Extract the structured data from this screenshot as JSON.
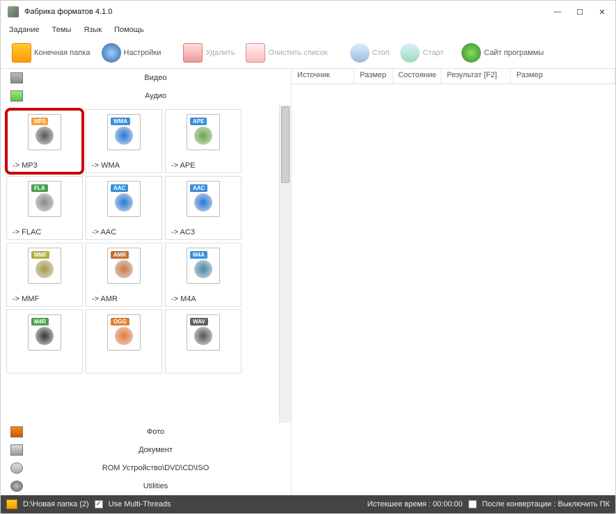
{
  "title": "Фабрика форматов 4.1.0",
  "menu": {
    "task": "Задание",
    "theme": "Темы",
    "lang": "Язык",
    "help": "Помощь"
  },
  "toolbar": {
    "output_folder": "Конечная папка",
    "settings": "Настройки",
    "delete": "Удалить",
    "clear": "Очистить список",
    "stop": "Стоп",
    "start": "Старт",
    "site": "Сайт программы"
  },
  "categories": {
    "video": "Видео",
    "audio": "Аудио",
    "photo": "Фото",
    "document": "Документ",
    "rom": "ROM Устройство\\DVD\\CD\\ISO",
    "utilities": "Utilities"
  },
  "formats": [
    {
      "tag": "MP3",
      "label": "-> MP3",
      "tagcls": "tag-mp3",
      "highlight": true
    },
    {
      "tag": "WMA",
      "label": "-> WMA",
      "tagcls": "tag-wma"
    },
    {
      "tag": "APE",
      "label": "-> APE",
      "tagcls": "tag-ape"
    },
    {
      "tag": "FLA",
      "label": "-> FLAC",
      "tagcls": "tag-fla"
    },
    {
      "tag": "AAC",
      "label": "-> AAC",
      "tagcls": "tag-aac"
    },
    {
      "tag": "AAC",
      "label": "-> AC3",
      "tagcls": "tag-aac"
    },
    {
      "tag": "MMF",
      "label": "-> MMF",
      "tagcls": "tag-mmf"
    },
    {
      "tag": "AMR",
      "label": "-> AMR",
      "tagcls": "tag-amr"
    },
    {
      "tag": "M4A",
      "label": "-> M4A",
      "tagcls": "tag-m4a"
    },
    {
      "tag": "M4R",
      "label": "",
      "tagcls": "tag-m4r"
    },
    {
      "tag": "OGG",
      "label": "",
      "tagcls": "tag-ogg"
    },
    {
      "tag": "WAV",
      "label": "",
      "tagcls": "tag-wav"
    }
  ],
  "columns": {
    "source": "Источник",
    "size": "Размер",
    "state": "Состояние",
    "result": "Результат [F2]",
    "size2": "Размер"
  },
  "status": {
    "path": "D:\\Новая папка (2)",
    "threads_label": "Use Multi-Threads",
    "threads_checked": "✓",
    "elapsed": "Истекшее время : 00:00:00",
    "after_conv": "После конвертации : Выключить ПК",
    "after_checked": ""
  }
}
